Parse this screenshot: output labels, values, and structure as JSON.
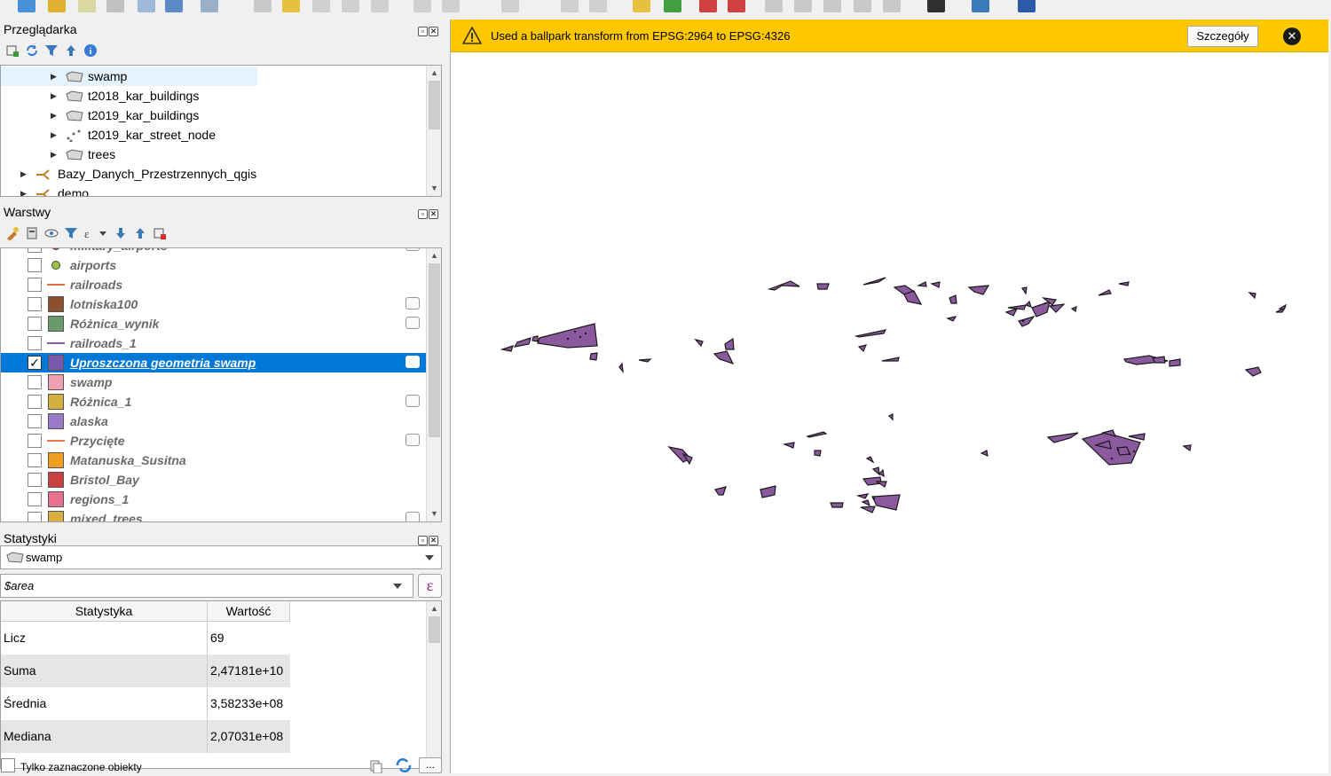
{
  "browser": {
    "title": "Przeglądarka",
    "items": [
      {
        "label": "swamp",
        "icon": "polygon-layer-icon"
      },
      {
        "label": "t2018_kar_buildings",
        "icon": "polygon-layer-icon"
      },
      {
        "label": "t2019_kar_buildings",
        "icon": "polygon-layer-icon"
      },
      {
        "label": "t2019_kar_street_node",
        "icon": "point-layer-icon"
      },
      {
        "label": "trees",
        "icon": "polygon-layer-icon"
      },
      {
        "label": "Bazy_Danych_Przestrzennych_qgis",
        "icon": "postgis-connection-icon"
      },
      {
        "label": "demo",
        "icon": "postgis-connection-icon"
      }
    ]
  },
  "layers": {
    "title": "Warstwy",
    "items": [
      {
        "label": "military_airports",
        "color": "#c04060",
        "checked": false
      },
      {
        "label": "airports",
        "color": "#a0c040",
        "checked": false
      },
      {
        "label": "railroads",
        "color": "#e07040",
        "checked": false
      },
      {
        "label": "lotniska100",
        "color": "#8b5030",
        "checked": false
      },
      {
        "label": "Różnica_wynik",
        "color": "#6a9a6a",
        "checked": false
      },
      {
        "label": "railroads_1",
        "color": "#8a5ab0",
        "checked": false
      },
      {
        "label": "Uproszczona geometria swamp",
        "color": "#7a5ab0",
        "checked": true
      },
      {
        "label": "swamp",
        "color": "#f0a0b0",
        "checked": false
      },
      {
        "label": "Różnica_1",
        "color": "#d4b040",
        "checked": false
      },
      {
        "label": "alaska",
        "color": "#9a7ac8",
        "checked": false
      },
      {
        "label": "Przycięte",
        "color": "#f07050",
        "checked": false
      },
      {
        "label": "Matanuska_Susitna",
        "color": "#f0a020",
        "checked": false
      },
      {
        "label": "Bristol_Bay",
        "color": "#c84040",
        "checked": false
      },
      {
        "label": "regions_1",
        "color": "#e87090",
        "checked": false
      },
      {
        "label": "mixed_trees",
        "color": "#d8b040",
        "checked": false
      }
    ]
  },
  "stats": {
    "title": "Statystyki",
    "layer": "swamp",
    "field": "$area",
    "headers": [
      "Statystyka",
      "Wartość"
    ],
    "rows": [
      [
        "Licz",
        "69"
      ],
      [
        "Suma",
        "2,47181e+10"
      ],
      [
        "Średnia",
        "3,58233e+08"
      ],
      [
        "Mediana",
        "2,07031e+08"
      ]
    ],
    "selected_only_label": "Tylko zaznaczone obiekty",
    "more_button": "..."
  },
  "message_bar": {
    "text": "Used a ballpark transform from EPSG:2964 to EPSG:4326",
    "details_button": "Szczegóły"
  },
  "map": {
    "fill_color": "#8b5a9e",
    "stroke_color": "#1a1a1a"
  }
}
